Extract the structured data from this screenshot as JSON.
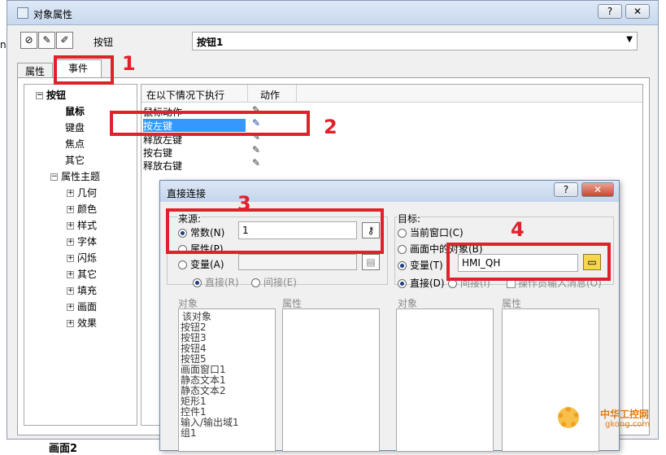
{
  "window": {
    "title": "对象属性"
  },
  "titlebar_buttons": {
    "help": "?",
    "close": "✕"
  },
  "toolbar": {
    "object_type": "按钮",
    "object_name": "按钮1"
  },
  "tabs": [
    {
      "label": "属性"
    },
    {
      "label": "事件"
    }
  ],
  "tree": {
    "root": "按钮",
    "items": [
      "鼠标",
      "键盘",
      "焦点",
      "其它"
    ],
    "group": "属性主题",
    "subitems": [
      "几何",
      "颜色",
      "样式",
      "字体",
      "闪烁",
      "其它",
      "填充",
      "画面",
      "效果"
    ]
  },
  "events_table": {
    "headers": [
      "在以下情况下执行",
      "动作"
    ],
    "rows": [
      "鼠标动作",
      "按左键",
      "释放左键",
      "按右键",
      "释放右键"
    ],
    "selected_row": "按左键"
  },
  "dialog": {
    "title": "直接连接",
    "source": {
      "group_label": "来源:",
      "constant_label": "常数(N)",
      "constant_value": "1",
      "property_label": "属性(P)",
      "variable_label": "变量(A)",
      "direct_label": "直接(R)",
      "indirect_label": "间接(E)",
      "object_header": "对象",
      "property_header": "属性",
      "objects": [
        "该对象",
        "按钮2",
        "按钮3",
        "按钮4",
        "按钮5",
        "画面窗口1",
        "静态文本1",
        "静态文本2",
        "矩形1",
        "控件1",
        "输入/输出域1",
        "组1"
      ]
    },
    "target": {
      "group_label": "目标:",
      "current_window_label": "当前窗口(C)",
      "screen_object_label": "画面中的对象(B)",
      "variable_label": "变量(T)",
      "variable_value": "HMI_QH",
      "direct_label": "直接(D)",
      "indirect_label": "间接(I)",
      "operator_msg_label": "操作员输入消息(O)",
      "object_header": "对象",
      "property_header": "属性"
    }
  },
  "annotations": {
    "n1": "1",
    "n2": "2",
    "n3": "3",
    "n4": "4"
  },
  "watermark": {
    "line1": "中华工控网",
    "line2": "gkong.com"
  },
  "background_text": {
    "bottom": "画面2",
    "left": "nc"
  },
  "colors": {
    "selection": "#3399ff",
    "annotation_red": "#e0212a"
  }
}
